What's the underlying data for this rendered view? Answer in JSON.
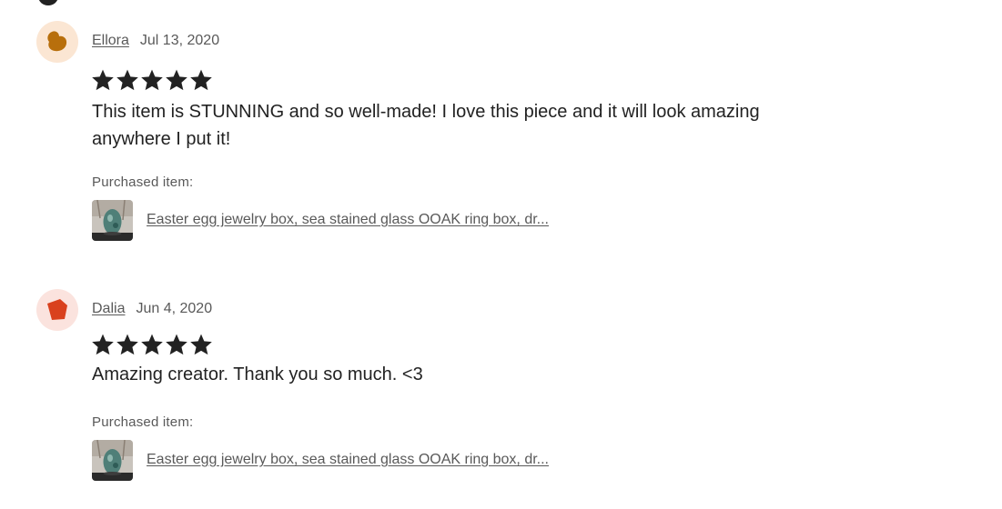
{
  "reviews": [
    {
      "reviewer": "Ellora",
      "date": "Jul 13, 2020",
      "rating": 5,
      "text": "This item is STUNNING and so well-made! I love this piece and it will look amazing anywhere I put it!",
      "purchased_label": "Purchased item:",
      "item_title": "Easter egg jewelry box, sea stained glass OOAK ring box, dr...",
      "avatar_color": "#b86f0c",
      "avatar_bg": "#fbe6d3"
    },
    {
      "reviewer": "Dalia",
      "date": "Jun 4, 2020",
      "rating": 5,
      "text": "Amazing creator. Thank you so much. <3",
      "purchased_label": "Purchased item:",
      "item_title": "Easter egg jewelry box, sea stained glass OOAK ring box, dr...",
      "avatar_color": "#d9411e",
      "avatar_bg": "#fbe3de"
    }
  ],
  "colors": {
    "text": "#222222",
    "muted": "#595959",
    "star": "#222222"
  },
  "icons": {
    "star": "star-icon",
    "avatar_ellora": "blob-avatar-icon",
    "avatar_dalia": "pentagon-avatar-icon"
  }
}
